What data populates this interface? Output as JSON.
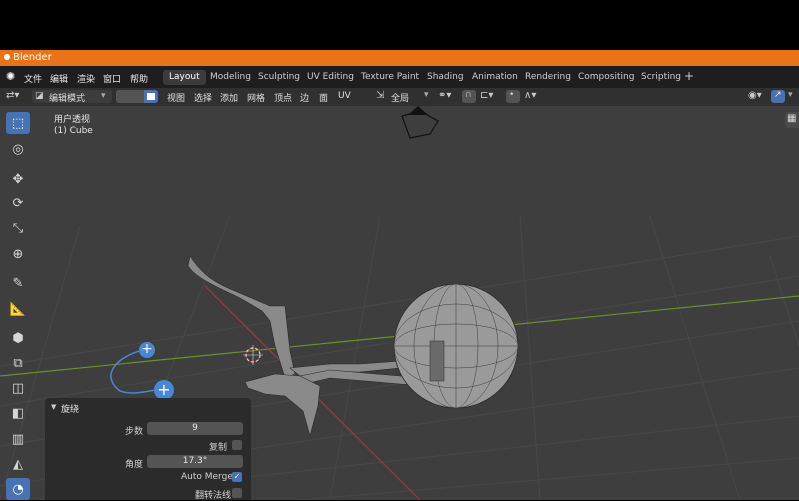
{
  "window": {
    "title": "Blender"
  },
  "menu": {
    "items": [
      "文件",
      "编辑",
      "渲染",
      "窗口",
      "帮助"
    ]
  },
  "workspaces": [
    "Layout",
    "Modeling",
    "Sculpting",
    "UV Editing",
    "Texture Paint",
    "Shading",
    "Animation",
    "Rendering",
    "Compositing",
    "Scripting"
  ],
  "active_workspace": "Layout",
  "header": {
    "mode": "编辑模式",
    "menus": [
      "视图",
      "选择",
      "添加",
      "网格",
      "顶点",
      "边",
      "面",
      "UV"
    ],
    "orientation": "全局"
  },
  "viewport": {
    "view_name": "用户透视",
    "object_label": "(1) Cube"
  },
  "operator_panel": {
    "title": "旋绕",
    "steps_label": "步数",
    "steps_value": "9",
    "dupli_label": "复制",
    "dupli_checked": false,
    "angle_label": "角度",
    "angle_value": "17.3°",
    "automerge_label": "Auto Merge",
    "automerge_checked": true,
    "flip_label": "翻转法线",
    "flip_checked": false
  },
  "colors": {
    "accent": "#4772b3",
    "titlebar": "#e8731b",
    "x_axis": "#9c3a44",
    "y_axis": "#6b8f2c"
  }
}
